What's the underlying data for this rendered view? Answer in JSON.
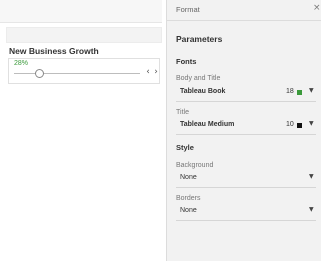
{
  "parameter_card": {
    "title": "New Business Growth",
    "value": "28%",
    "slider_position": 0.2,
    "prev_symbol": "‹",
    "next_symbol": "›"
  },
  "format_panel": {
    "title": "Format",
    "close_symbol": "×",
    "section_title": "Parameters",
    "fonts": {
      "heading": "Fonts",
      "body_title_label": "Body and Title",
      "body_title_font": "Tableau Book",
      "body_title_size": "18",
      "body_title_color": "#3c9a3c",
      "title_label": "Title",
      "title_font": "Tableau Medium",
      "title_size": "10",
      "title_color": "#111111"
    },
    "style": {
      "heading": "Style",
      "background_label": "Background",
      "background_value": "None",
      "borders_label": "Borders",
      "borders_value": "None"
    },
    "caret_symbol": "▼"
  }
}
